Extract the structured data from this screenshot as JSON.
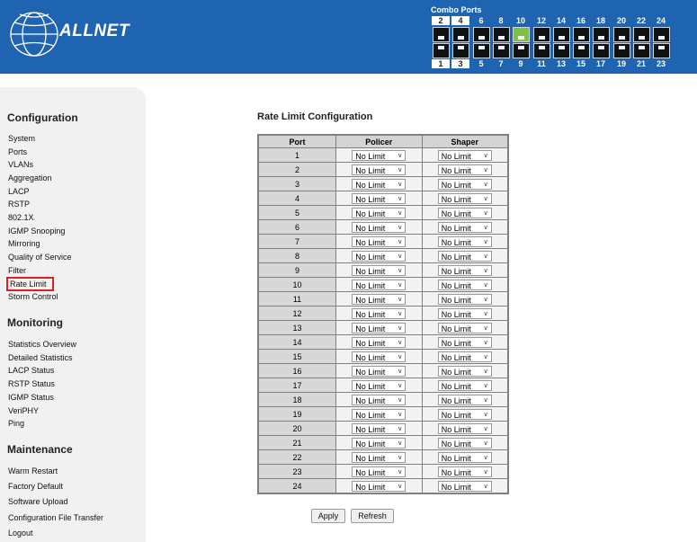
{
  "header": {
    "brand": "ALLNET",
    "combo_label": "Combo Ports",
    "top_port_numbers": [
      "2",
      "4",
      "6",
      "8",
      "10",
      "12",
      "14",
      "16",
      "18",
      "20",
      "22",
      "24"
    ],
    "bottom_port_numbers": [
      "1",
      "3",
      "5",
      "7",
      "9",
      "11",
      "13",
      "15",
      "17",
      "19",
      "21",
      "23"
    ],
    "active_port": "10",
    "colors": {
      "header_bg": "#1f64b0",
      "active_port": "#7cc142"
    }
  },
  "sidebar": {
    "configuration_title": "Configuration",
    "configuration_items": [
      "System",
      "Ports",
      "VLANs",
      "Aggregation",
      "LACP",
      "RSTP",
      "802.1X",
      "IGMP Snooping",
      "Mirroring",
      "Quality of Service",
      "Filter",
      "Rate Limit",
      "Storm Control"
    ],
    "selected_item": "Rate Limit",
    "monitoring_title": "Monitoring",
    "monitoring_items": [
      "Statistics Overview",
      "Detailed Statistics",
      "LACP Status",
      "RSTP Status",
      "IGMP Status",
      "VeriPHY",
      "Ping"
    ],
    "maintenance_title": "Maintenance",
    "maintenance_items": [
      "Warm Restart",
      "Factory Default",
      "Software Upload",
      "Configuration File Transfer",
      "Logout"
    ]
  },
  "main": {
    "title": "Rate Limit Configuration",
    "columns": [
      "Port",
      "Policer",
      "Shaper"
    ],
    "rows": [
      {
        "port": "1",
        "policer": "No Limit",
        "shaper": "No Limit"
      },
      {
        "port": "2",
        "policer": "No Limit",
        "shaper": "No Limit"
      },
      {
        "port": "3",
        "policer": "No Limit",
        "shaper": "No Limit"
      },
      {
        "port": "4",
        "policer": "No Limit",
        "shaper": "No Limit"
      },
      {
        "port": "5",
        "policer": "No Limit",
        "shaper": "No Limit"
      },
      {
        "port": "6",
        "policer": "No Limit",
        "shaper": "No Limit"
      },
      {
        "port": "7",
        "policer": "No Limit",
        "shaper": "No Limit"
      },
      {
        "port": "8",
        "policer": "No Limit",
        "shaper": "No Limit"
      },
      {
        "port": "9",
        "policer": "No Limit",
        "shaper": "No Limit"
      },
      {
        "port": "10",
        "policer": "No Limit",
        "shaper": "No Limit"
      },
      {
        "port": "11",
        "policer": "No Limit",
        "shaper": "No Limit"
      },
      {
        "port": "12",
        "policer": "No Limit",
        "shaper": "No Limit"
      },
      {
        "port": "13",
        "policer": "No Limit",
        "shaper": "No Limit"
      },
      {
        "port": "14",
        "policer": "No Limit",
        "shaper": "No Limit"
      },
      {
        "port": "15",
        "policer": "No Limit",
        "shaper": "No Limit"
      },
      {
        "port": "16",
        "policer": "No Limit",
        "shaper": "No Limit"
      },
      {
        "port": "17",
        "policer": "No Limit",
        "shaper": "No Limit"
      },
      {
        "port": "18",
        "policer": "No Limit",
        "shaper": "No Limit"
      },
      {
        "port": "19",
        "policer": "No Limit",
        "shaper": "No Limit"
      },
      {
        "port": "20",
        "policer": "No Limit",
        "shaper": "No Limit"
      },
      {
        "port": "21",
        "policer": "No Limit",
        "shaper": "No Limit"
      },
      {
        "port": "22",
        "policer": "No Limit",
        "shaper": "No Limit"
      },
      {
        "port": "23",
        "policer": "No Limit",
        "shaper": "No Limit"
      },
      {
        "port": "24",
        "policer": "No Limit",
        "shaper": "No Limit"
      }
    ],
    "apply_label": "Apply",
    "refresh_label": "Refresh"
  }
}
